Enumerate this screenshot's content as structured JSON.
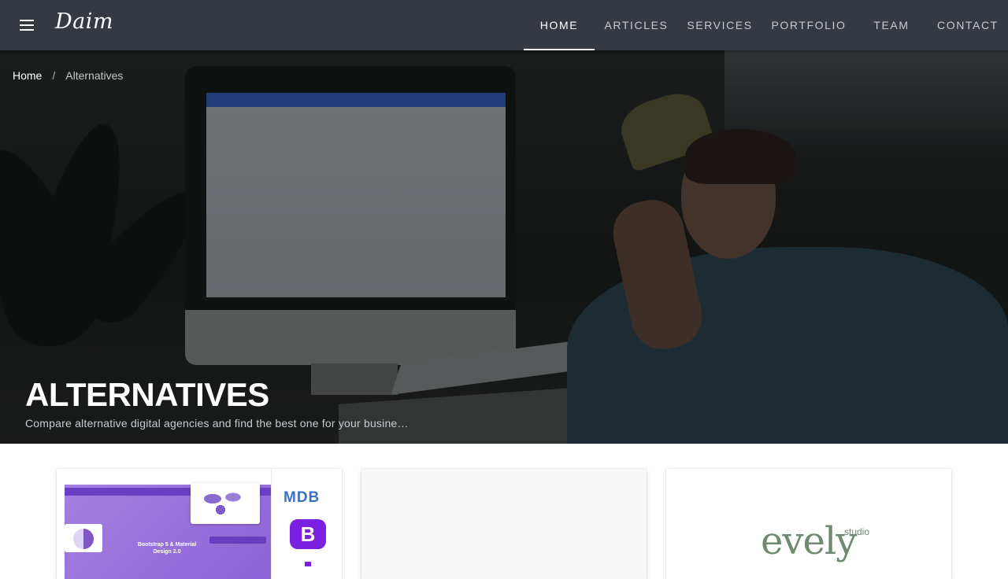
{
  "header": {
    "brand": "Daim",
    "menu_icon": "hamburger-menu-icon",
    "nav": [
      {
        "label": "HOME",
        "active": true
      },
      {
        "label": "ARTICLES",
        "active": false
      },
      {
        "label": "SERVICES",
        "active": false
      },
      {
        "label": "PORTFOLIO",
        "active": false
      },
      {
        "label": "TEAM",
        "active": false
      },
      {
        "label": "CONTACT",
        "active": false
      }
    ]
  },
  "breadcrumb": {
    "home": "Home",
    "separator": "/",
    "current": "Alternatives"
  },
  "hero": {
    "title": "ALTERNATIVES",
    "subtitle": "Compare alternative digital agencies and find the best one for your busine…"
  },
  "cards": [
    {
      "logo_text": "MDB",
      "thumb_caption": "Bootstrap 5 & Material Design 2.0",
      "badge_letter": "B"
    },
    {},
    {
      "logo_text": "evely",
      "logo_sub": "studio"
    }
  ],
  "colors": {
    "topbar": "#353941",
    "mdb_purple": "#7b1fe0",
    "mdb_blue": "#3b71ca",
    "evely_green": "#6f8a70"
  }
}
